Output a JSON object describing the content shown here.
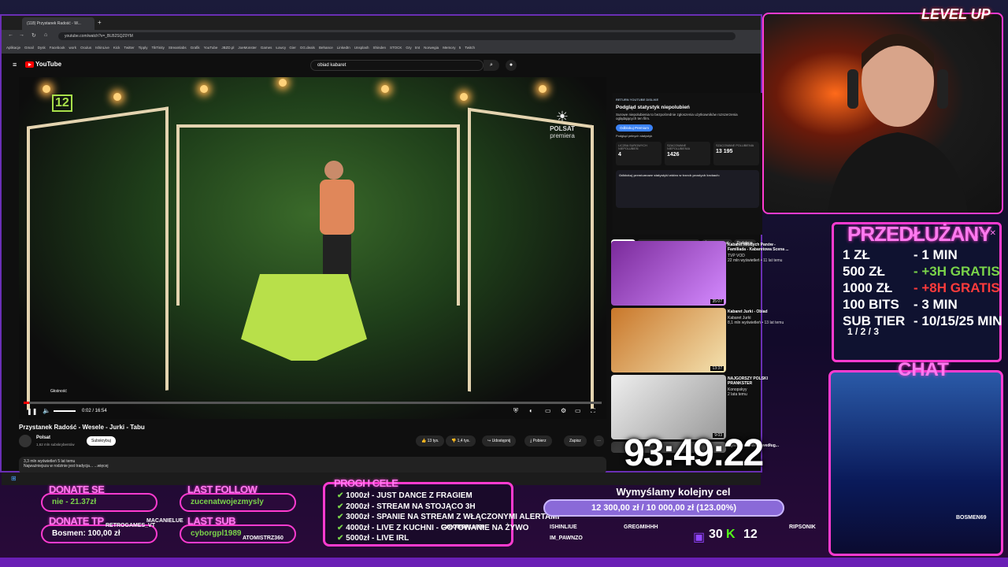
{
  "browser": {
    "tab_title": "(118) Przystanek Radość - W...",
    "url": "youtube.com/watch?v=_BLB2SQZ0YM",
    "bookmarks": [
      "Aplikacje",
      "Gmail",
      "Dysk",
      "Facebook",
      "work",
      "Oculus",
      "IshinLive",
      "Kick",
      "Twitter",
      "Tipply",
      "TikTinity",
      "Streamlabs",
      "Grafik",
      "YouTube",
      "JBZD.pl",
      "JoeMonster",
      "Games",
      "Łowcy Gier",
      "GG.deals",
      "Behance",
      "LinkedIn",
      "Unsplash",
      "Shinden",
      "STOCK",
      "Gry tmt",
      "Norwegia",
      "Memory 5",
      "Twitch"
    ]
  },
  "youtube": {
    "logo": "YouTube",
    "search_value": "obiad kabaret",
    "video": {
      "tooltip": "Głośność",
      "time": "0:02 / 16:54",
      "channel_badge": "12",
      "watermark": "POLSAT",
      "watermark_sub": "premiera",
      "title": "Przystanek Radość - Wesele - Jurki - Tabu",
      "channel": "Polsat",
      "subscribers": "1,62 mln subskrybentów",
      "subscribe": "Subskrybuj",
      "likes": "13 tys.",
      "dislikes": "1,4 tys.",
      "share": "Udostępnij",
      "download": "Pobierz",
      "save": "Zapisz",
      "description_line1": "3,3 mln wyświetleń  5 lat temu",
      "description_line2": "Najważniejsza w rodzinie jest tradycja... ...więcej"
    },
    "dislike_panel": {
      "header": "RETURN YOUTUBE DISLIKE",
      "title": "Podgląd statystyk niepolubień",
      "body": "Surowe niepolubienia to bezpośrednie zgłoszenia użytkowników rozszerzenia oglądających ten film.",
      "button": "Odblokuj Premium",
      "sub": "Podgląd pełnych statystyk",
      "stats": [
        {
          "label": "LICZBA SUROWYCH NIEPOLUBIEŃ",
          "value": "4"
        },
        {
          "label": "SZACOWANE NIEPOLUBIENIA",
          "value": "1426"
        },
        {
          "label": "SZACOWANE POLUBIENIA",
          "value": "13 195"
        }
      ],
      "unlock_title": "Odblokuj premiumowe statystyki wideo w trzech prostych krokach:"
    },
    "tabs": [
      "Wszystkie",
      "Z Twoich wyników wyszukiwania",
      "Źródło: Polsat",
      "Podobne"
    ],
    "recommendations": [
      {
        "title": "Kabaret Młodych Panów - Familiada - Kabaretowa Scena ...",
        "channel": "TVP VOD",
        "meta": "22 mln wyświetleń • 11 lat temu",
        "duration": "35:07"
      },
      {
        "title": "Kabaret Jurki - Obiad",
        "channel": "Kabaret Jurki",
        "meta": "8,1 mln wyświetleń • 13 lat temu",
        "duration": "13:37"
      },
      {
        "title": "NAJGORSZY POLSKI PRANKSTER",
        "channel": "Konopskyy",
        "meta": "2 lata temu",
        "duration": "9:03"
      },
      {
        "title": "Myśliwiec U-Wing według...",
        "channel": "",
        "meta": "",
        "duration": ""
      }
    ]
  },
  "overlay": {
    "brand": "LEVEL UP",
    "prz_title": "PRZEDŁUŻANY",
    "prz_rows": [
      {
        "left": "1 ZŁ",
        "right": "- 1 MIN",
        "color": "#ffffff"
      },
      {
        "left": "500 ZŁ",
        "right": "- +3H GRATIS",
        "color": "#7ad44a"
      },
      {
        "left": "1000 ZŁ",
        "right": "- +8H GRATIS",
        "color": "#ff3b3b"
      },
      {
        "left": "100 BITS",
        "right": "- 3 MIN",
        "color": "#ffffff"
      },
      {
        "left": "SUB TIER",
        "right": "- 10/15/25 MIN",
        "color": "#ffffff"
      }
    ],
    "sub_tiers": "1 / 2 / 3",
    "chat_title": "CHAT",
    "donate_label": "DONATE SE",
    "donate_value": "nie - 21.37zł",
    "donate_tp_label": "DONATE TP",
    "donate_tp_value": "Bosmen: 100,00 zł",
    "last_follow_label": "LAST FOLLOW",
    "last_follow_value": "zucenatwojezmysly",
    "last_sub_label": "LAST SUB",
    "last_sub_value": "cyborgpl1989",
    "progi_title": "PROGI I CELE",
    "progi": [
      "1000zł - JUST DANCE Z FRAGIEM",
      "2000zł - STREAM NA STOJĄCO 3H",
      "3000zł - SPANIE NA STREAM Z WŁĄCZONYMI ALERTAMI",
      "4000zł - LIVE Z KUCHNI - GOTOWANIE NA ŻYWO",
      "5000zł - LIVE IRL"
    ],
    "goal_title": "Wymyślamy kolejny cel",
    "goal_value": "12 300,00 zł / 10 000,00 zł (123.00%)",
    "goal_progress": 1.23,
    "timer": "93:49:22",
    "twitch_count": "30",
    "kick_count": "12",
    "usernames": [
      "RETROGAMES_VT",
      "MACANIELUE",
      "ATOMISTRZ360",
      "IM_PAWNZO",
      "ISHINLIUE",
      "GREGMIHHH",
      "CYBORGPL1989",
      "RIPSONIK",
      "BOSMEN69"
    ]
  }
}
